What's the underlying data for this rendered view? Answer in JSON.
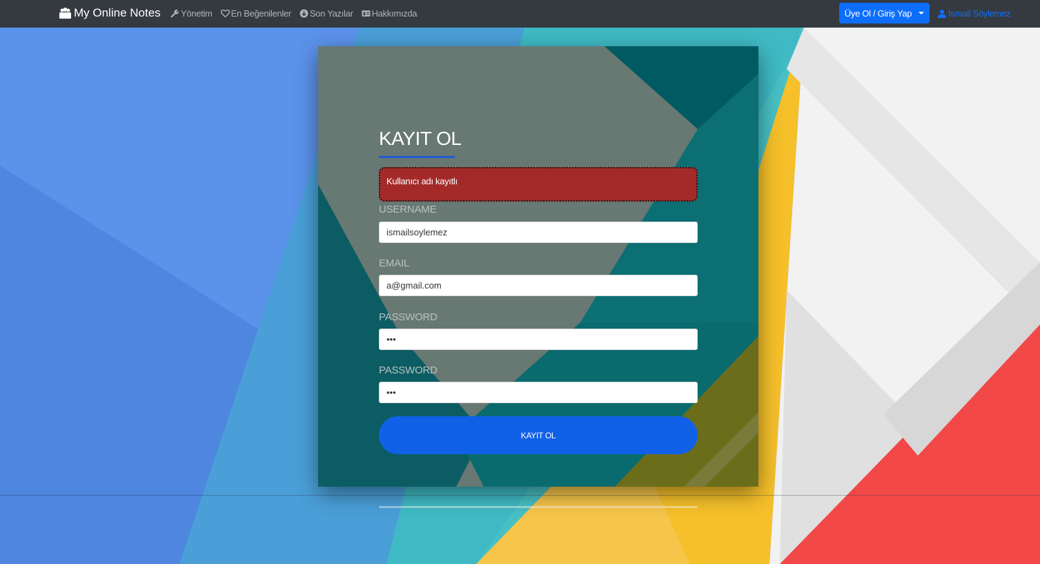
{
  "navbar": {
    "brand": "My Online Notes",
    "links": [
      {
        "label": "Yönetim",
        "icon": "wrench-icon"
      },
      {
        "label": "En Beğenilenler",
        "icon": "heart-icon"
      },
      {
        "label": "Son Yazılar",
        "icon": "arrow-circle-down-icon"
      },
      {
        "label": "Hakkımızda",
        "icon": "id-card-icon"
      }
    ],
    "dropdown_label": "Üye Ol / Giriş Yap",
    "user_name": "İsmail Söylemez"
  },
  "form": {
    "title": "KAYIT OL",
    "error_message": "Kullanıcı adı kayıtlı",
    "username_label": "USERNAME",
    "username_value": "ismailsoylemez",
    "email_label": "EMAIL",
    "email_value": "a@gmail.com",
    "password_label": "PASSWORD",
    "password_value": "•••",
    "password_confirm_label": "PASSWORD",
    "password_confirm_value": "•••",
    "submit_label": "KAYIT OL"
  },
  "colors": {
    "navbar_bg": "#343a40",
    "primary": "#0d6efd",
    "alert_bg": "#a42a2a",
    "submit_bg": "#1160e8"
  }
}
